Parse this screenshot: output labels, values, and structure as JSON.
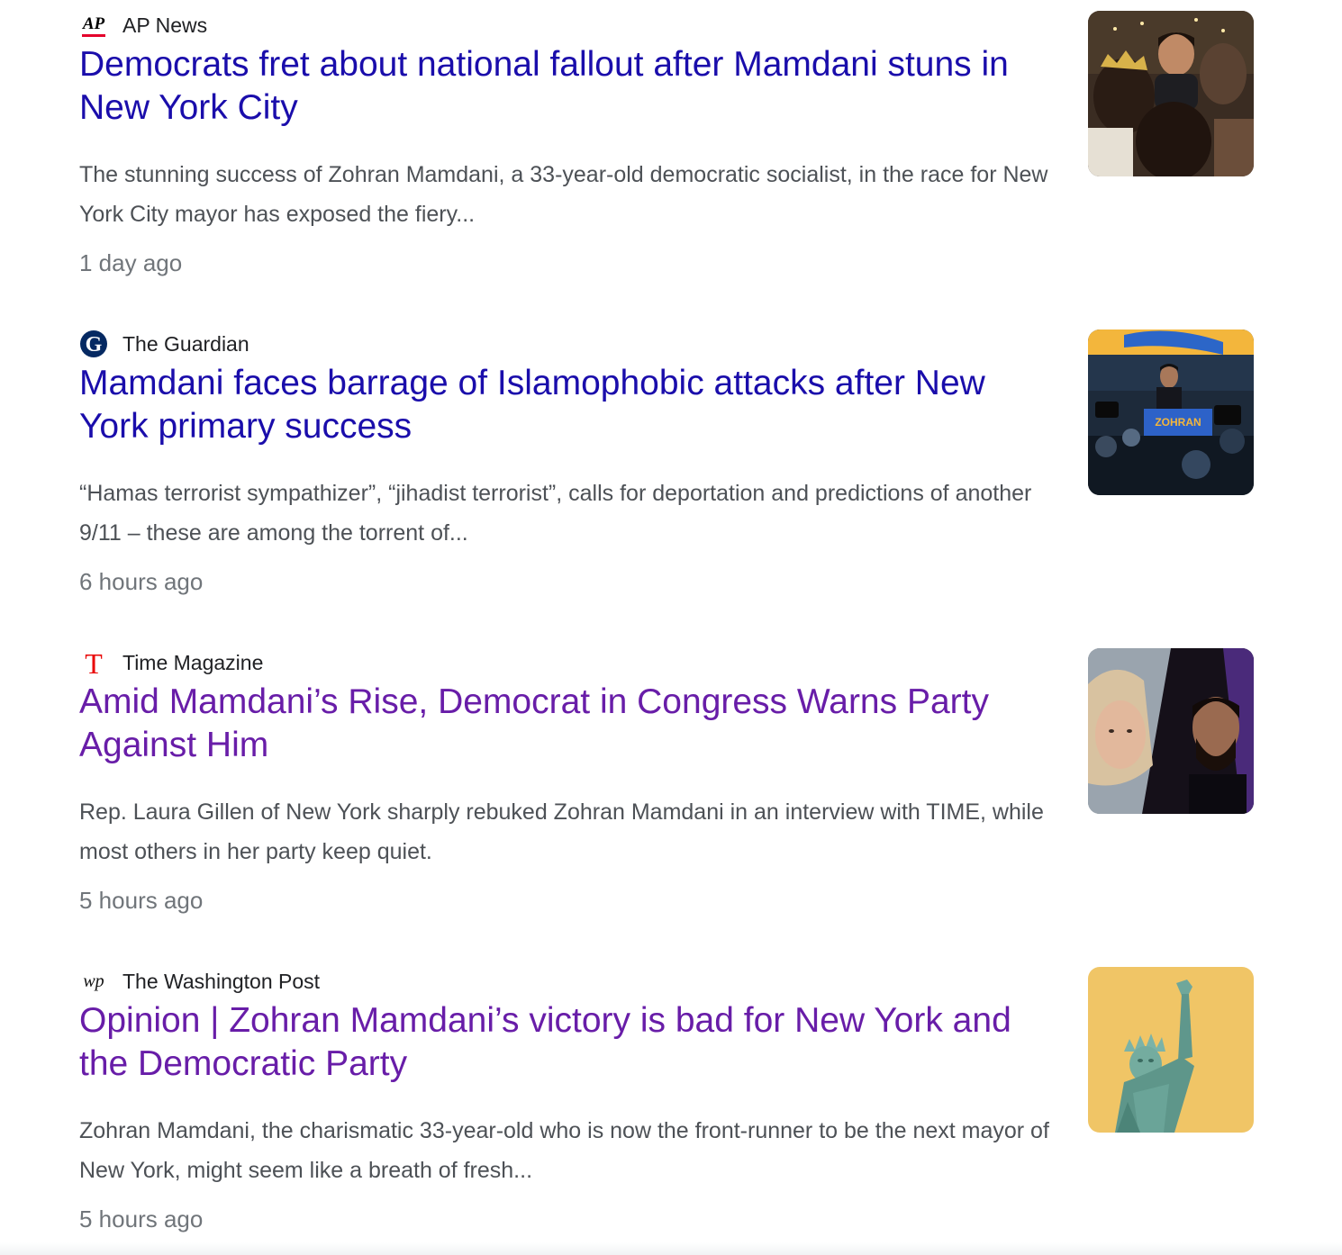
{
  "articles": [
    {
      "source": "AP News",
      "logo_icon": "ap-news-logo-icon",
      "headline": "Democrats fret about national fallout after Mamdani stuns in New York City",
      "snippet": "The stunning success of Zohran Mamdani, a 33-year-old democratic socialist, in the race for New York City mayor has exposed the fiery...",
      "time": "1 day ago",
      "visited": false,
      "thumbnail_icon": "crowd-selfie-photo-icon"
    },
    {
      "source": "The Guardian",
      "logo_icon": "guardian-logo-icon",
      "headline": "Mamdani faces barrage of Islamophobic attacks after New York primary success",
      "snippet": "“Hamas terrorist sympathizer”, “jihadist terrorist”, calls for deportation and predictions of another 9/11 – these are among the torrent of...",
      "time": "6 hours ago",
      "visited": false,
      "thumbnail_icon": "rally-podium-photo-icon",
      "thumbnail_sign": "ZOHRAN"
    },
    {
      "source": "Time Magazine",
      "logo_icon": "time-logo-icon",
      "headline": "Amid Mamdani’s Rise, Democrat in Congress Warns Party Against Him",
      "snippet": "Rep. Laura Gillen of New York sharply rebuked Zohran Mamdani in an interview with TIME, while most others in her party keep quiet.",
      "time": "5 hours ago",
      "visited": true,
      "thumbnail_icon": "split-portrait-photo-icon"
    },
    {
      "source": "The Washington Post",
      "logo_icon": "washington-post-logo-icon",
      "headline": "Opinion | Zohran Mamdani’s victory is bad for New York and the Democratic Party",
      "snippet": "Zohran Mamdani, the charismatic 33-year-old who is now the front-runner to be the next mayor of New York, might seem like a breath of fresh...",
      "time": "5 hours ago",
      "visited": true,
      "thumbnail_icon": "statue-of-liberty-illustration-icon"
    }
  ],
  "colors": {
    "headline_link": "#1a0dab",
    "headline_visited": "#681da8",
    "snippet_text": "#4d5156",
    "time_text": "#70757a",
    "ap_red": "#e4002b",
    "time_red": "#e90606",
    "liberty_background": "#f0c566"
  }
}
